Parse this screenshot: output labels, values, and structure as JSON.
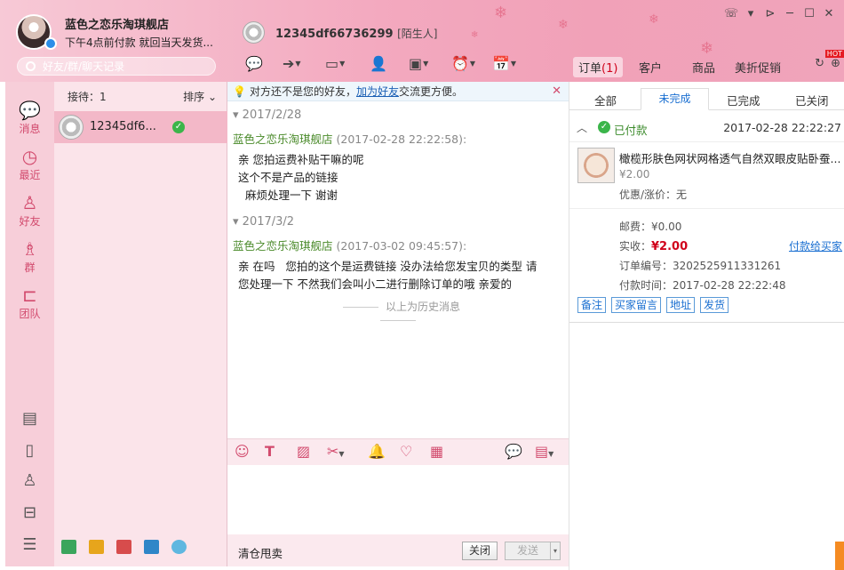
{
  "header": {
    "shop_name": "蓝色之恋乐淘琪舰店",
    "shop_status": "下午4点前付款  就回当天发货...",
    "search_placeholder": "好友/群/聊天记录",
    "contact_name": "12345df66736299",
    "contact_tag": "[陌生人]",
    "tabs": [
      {
        "label": "订单",
        "count": "(1)"
      },
      {
        "label": "客户"
      },
      {
        "label": "商品"
      },
      {
        "label": "美折促销"
      }
    ],
    "hot_badge": "HOT"
  },
  "nav": {
    "items": [
      {
        "label": "消息"
      },
      {
        "label": "最近"
      },
      {
        "label": "好友"
      },
      {
        "label": "群"
      },
      {
        "label": "团队"
      }
    ]
  },
  "contacts": {
    "reception": "接待：1",
    "sort": "排序",
    "rows": [
      {
        "name": "12345df6..."
      }
    ]
  },
  "chat": {
    "notice_prefix": "对方还不是您的好友，",
    "notice_link": "加为好友",
    "notice_suffix": "交流更方便。",
    "groups": [
      {
        "date": "2017/2/28",
        "sender": "蓝色之恋乐淘琪舰店",
        "time": "(2017-02-28 22:22:58):",
        "lines": [
          "亲 您拍运费补贴干嘛的呢",
          "这个不是产品的链接",
          "  麻烦处理一下 谢谢"
        ]
      },
      {
        "date": "2017/3/2",
        "sender": "蓝色之恋乐淘琪舰店",
        "time": "(2017-03-02 09:45:57):",
        "lines": [
          "亲 在吗   您拍的这个是运费链接 没办法给您发宝贝的类型 请",
          "您处理一下 不然我们会叫小二进行删除订单的哦 亲爱的"
        ]
      }
    ],
    "history_label": "以上为历史消息",
    "quick_reply": "清仓甩卖",
    "close_btn": "关闭",
    "send_btn": "发送"
  },
  "orders": {
    "tabs": [
      "全部",
      "未完成",
      "已完成",
      "已关闭"
    ],
    "status": "已付款",
    "time": "2017-02-28 22:22:27",
    "item_title": "橄榄形肤色网状网格透气自然双眼皮贴卧蚕...",
    "item_price": "¥2.00",
    "discount_label": "优惠/涨价：",
    "discount_value": "无",
    "postage_label": "邮费：",
    "postage_value": "¥0.00",
    "actual_label": "实收：",
    "actual_value": "¥2.00",
    "pay_link": "付款给买家",
    "order_no_label": "订单编号：",
    "order_no": "3202525911331261",
    "pay_time_label": "付款时间：",
    "pay_time": "2017-02-28 22:22:48",
    "buttons": [
      "备注",
      "买家留言",
      "地址",
      "发货"
    ]
  }
}
